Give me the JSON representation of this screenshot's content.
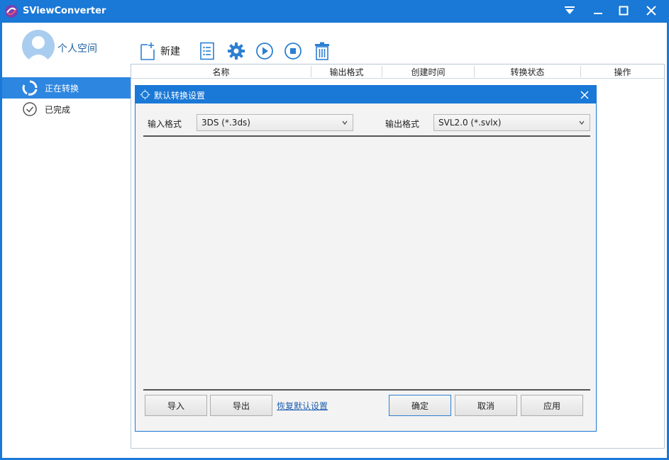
{
  "window": {
    "title": "SViewConverter",
    "colors": {
      "titlebar": "#1a78d6",
      "active": "#2d86e0",
      "link": "#1f5fb0"
    }
  },
  "sidebar": {
    "user_label": "个人空间",
    "items": [
      {
        "label": "正在转换",
        "active": true,
        "icon": "converting-icon"
      },
      {
        "label": "已完成",
        "active": false,
        "icon": "check-circle-icon"
      }
    ]
  },
  "toolbar": {
    "new_label": "新建",
    "icons": [
      "new-file-icon",
      "list-icon",
      "gear-icon",
      "play-icon",
      "stop-icon",
      "trash-icon"
    ]
  },
  "table": {
    "columns": [
      "名称",
      "输出格式",
      "创建时间",
      "转换状态",
      "操作"
    ]
  },
  "dialog": {
    "title": "默认转换设置",
    "input_format_label": "输入格式",
    "input_format_value": "3DS (*.3ds)",
    "output_format_label": "输出格式",
    "output_format_value": "SVL2.0 (*.svlx)",
    "buttons": {
      "import": "导入",
      "export": "导出",
      "restore_default": "恢复默认设置",
      "ok": "确定",
      "cancel": "取消",
      "apply": "应用"
    }
  }
}
